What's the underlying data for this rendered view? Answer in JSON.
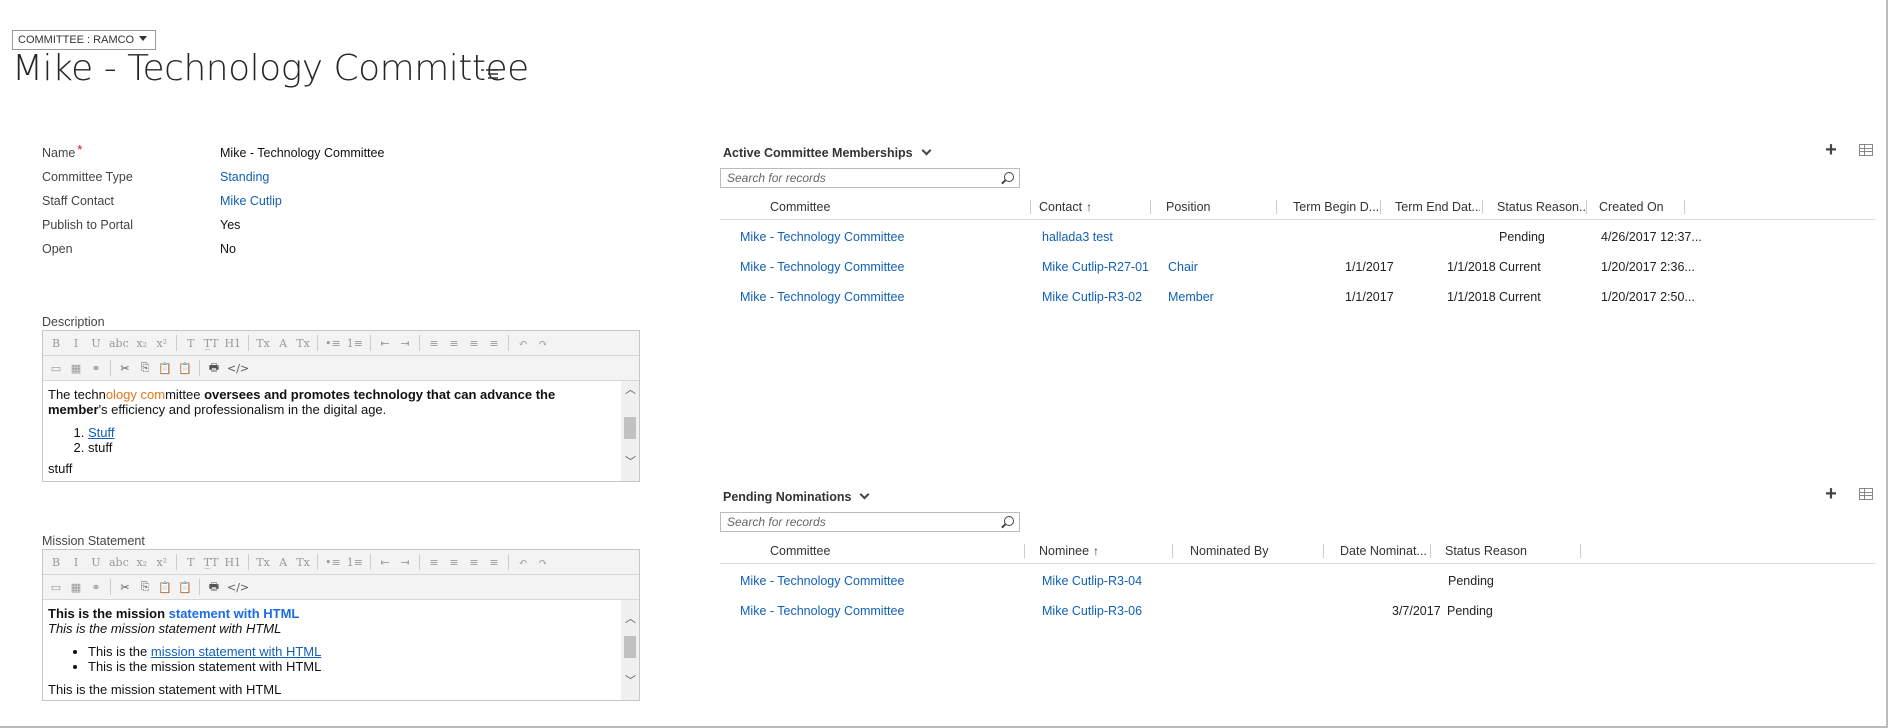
{
  "header": {
    "entity_switch": "COMMITTEE : RAMCO",
    "title": "Mike - Technology Committee",
    "title_menu_icon": "list-menu-icon"
  },
  "fields": [
    {
      "label": "Name",
      "value": "Mike - Technology Committee",
      "required": "*",
      "link": false
    },
    {
      "label": "Committee Type",
      "value": "Standing",
      "link": true
    },
    {
      "label": "Staff Contact",
      "value": "Mike Cutlip",
      "link": true
    },
    {
      "label": "Publish to Portal",
      "value": "Yes",
      "link": false
    },
    {
      "label": "Open",
      "value": "No",
      "link": false
    }
  ],
  "description": {
    "label": "Description",
    "line1_a": "The techn",
    "line1_b": "ology com",
    "line1_c": "mittee ",
    "line1_d": "oversees and promotes technology that can advance the",
    "line2_a": "member",
    "line2_b": "'s efficiency and professionalism in the digital age.",
    "list": [
      "Stuff",
      "stuff"
    ],
    "cut_line": "stuff"
  },
  "mission": {
    "label": "Mission Statement",
    "line1_a": "This is the mission ",
    "line1_b": "statement with HTML",
    "line2": "This is the mission statement with HTML",
    "bullet1_a": "This is the ",
    "bullet1_b": "mission statement with HTML",
    "bullet2": "This is the mission statement with HTML",
    "cut_line": "This is the mission statement with HTML"
  },
  "toolbar": {
    "row1": [
      "B",
      "I",
      "U",
      "abc",
      "x₂",
      "x²",
      "T",
      "T̲T",
      "H1",
      "Tx",
      "A",
      "Tx",
      "•≡",
      "1≡",
      "⇤",
      "⇥",
      "≡",
      "≡",
      "≡",
      "≡",
      "↶",
      "↷"
    ],
    "row2": [
      "▭",
      "▦",
      "⚭",
      "✂",
      "⎘",
      "📋",
      "📋",
      "🖶",
      "</>"
    ]
  },
  "memberships": {
    "title": "Active Committee Memberships",
    "search_placeholder": "Search for records",
    "columns": [
      "Committee",
      "Contact",
      "Position",
      "Term Begin D...",
      "Term End Dat...",
      "Status Reason...",
      "Created On"
    ],
    "sort_arrow": "↑",
    "rows": [
      {
        "committee": "Mike - Technology Committee",
        "contact": "hallada3 test",
        "position": "",
        "begin": "",
        "end": "",
        "status": "Pending",
        "created": "4/26/2017 12:37..."
      },
      {
        "committee": "Mike - Technology Committee",
        "contact": "Mike Cutlip-R27-01",
        "position": "Chair",
        "begin": "1/1/2017",
        "end": "1/1/2018",
        "status": "Current",
        "created": "1/20/2017 2:36..."
      },
      {
        "committee": "Mike - Technology Committee",
        "contact": "Mike Cutlip-R3-02",
        "position": "Member",
        "begin": "1/1/2017",
        "end": "1/1/2018",
        "status": "Current",
        "created": "1/20/2017 2:50..."
      }
    ]
  },
  "nominations": {
    "title": "Pending Nominations",
    "search_placeholder": "Search for records",
    "columns": [
      "Committee",
      "Nominee",
      "Nominated By",
      "Date Nominat...",
      "Status Reason"
    ],
    "sort_arrow": "↑",
    "rows": [
      {
        "committee": "Mike - Technology Committee",
        "nominee": "Mike Cutlip-R3-04",
        "by": "",
        "date": "",
        "status": "Pending"
      },
      {
        "committee": "Mike - Technology Committee",
        "nominee": "Mike Cutlip-R3-06",
        "by": "",
        "date": "3/7/2017",
        "status": "Pending"
      }
    ]
  },
  "icons": {
    "add": "+",
    "caret": "▾",
    "scroll_up": "︿",
    "scroll_down": "﹀"
  }
}
